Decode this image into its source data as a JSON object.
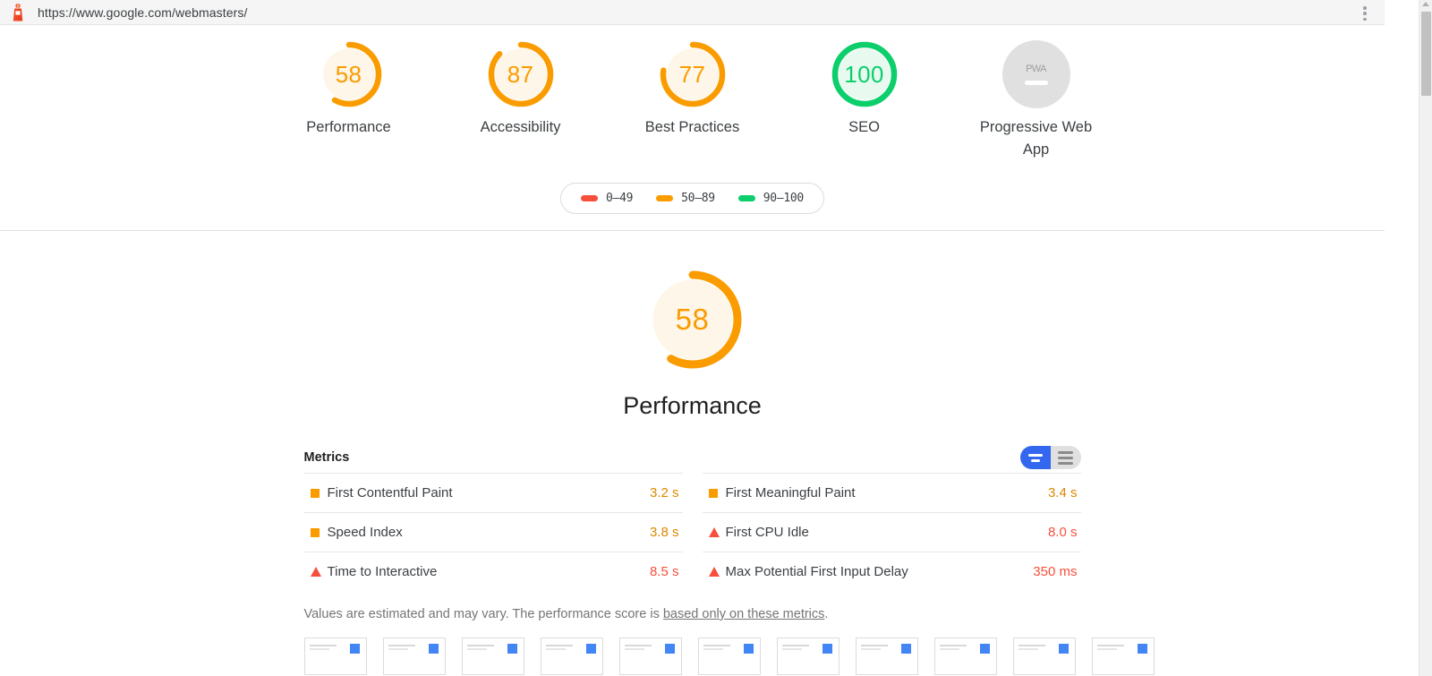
{
  "browser": {
    "url": "https://www.google.com/webmasters/",
    "lighthouse_icon": "lighthouse-icon",
    "menu_icon": "kebab-menu-icon",
    "scrollbar_up_icon": "scroll-up-arrow-icon"
  },
  "colors": {
    "red": "#f6503c",
    "orange": "#fa9c00",
    "green": "#0cce6b",
    "orange_text": "#e08600",
    "green_text": "#0cce6b",
    "gauge_bg_orange": "#fef6e8",
    "gauge_bg_green": "#e8faf0",
    "pwa_gray": "#e0e0e0",
    "toggle_blue": "#3367f0",
    "toggle_gray": "#e0e0e0"
  },
  "scores": [
    {
      "value": "58",
      "label": "Performance",
      "pct": 58,
      "state": "average",
      "type": "gauge"
    },
    {
      "value": "87",
      "label": "Accessibility",
      "pct": 87,
      "state": "average",
      "type": "gauge"
    },
    {
      "value": "77",
      "label": "Best Practices",
      "pct": 77,
      "state": "average",
      "type": "gauge"
    },
    {
      "value": "100",
      "label": "SEO",
      "pct": 100,
      "state": "pass",
      "type": "gauge"
    },
    {
      "value": "PWA",
      "label": "Progressive Web App",
      "pct": 0,
      "state": "null",
      "type": "badge"
    }
  ],
  "legend": {
    "items": [
      {
        "range": "0–49",
        "color": "#f6503c",
        "swatch": "legend-swatch-red"
      },
      {
        "range": "50–89",
        "color": "#fa9c00",
        "swatch": "legend-swatch-orange"
      },
      {
        "range": "90–100",
        "color": "#0cce6b",
        "swatch": "legend-swatch-green"
      }
    ]
  },
  "category": {
    "score": "58",
    "pct": 58,
    "title": "Performance"
  },
  "metrics": {
    "heading": "Metrics",
    "toggle": {
      "selected": "simple",
      "simple_icon": "toggle-simple-view-icon",
      "expanded_icon": "toggle-expanded-view-icon"
    },
    "left_column": [
      {
        "name": "First Contentful Paint",
        "value": "3.2 s",
        "state": "average",
        "marker": "square-marker-icon"
      },
      {
        "name": "Speed Index",
        "value": "3.8 s",
        "state": "average",
        "marker": "square-marker-icon"
      },
      {
        "name": "Time to Interactive",
        "value": "8.5 s",
        "state": "slow",
        "marker": "triangle-marker-icon"
      }
    ],
    "right_column": [
      {
        "name": "First Meaningful Paint",
        "value": "3.4 s",
        "state": "average",
        "marker": "square-marker-icon"
      },
      {
        "name": "First CPU Idle",
        "value": "8.0 s",
        "state": "slow",
        "marker": "triangle-marker-icon"
      },
      {
        "name": "Max Potential First Input Delay",
        "value": "350 ms",
        "state": "slow",
        "marker": "triangle-marker-icon"
      }
    ],
    "note_before": "Values are estimated and may vary. The performance score is ",
    "note_link": "based only on these metrics",
    "note_after": "."
  },
  "filmstrip": {
    "count": 11
  }
}
